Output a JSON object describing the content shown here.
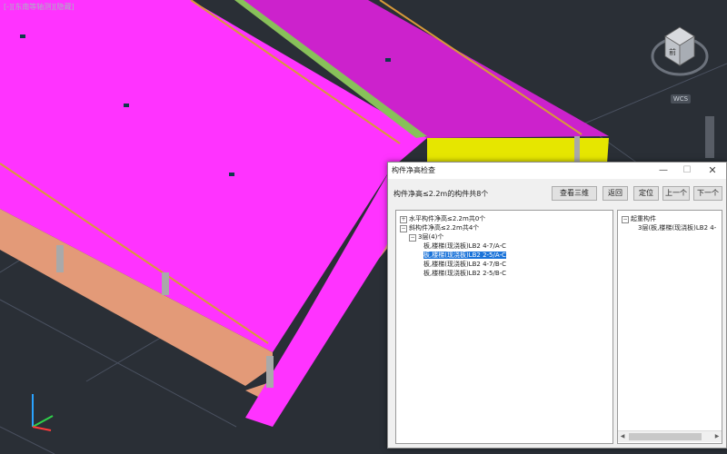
{
  "viewport": {
    "label": "[-][东南等轴测][隐藏]",
    "view_label": "WCS"
  },
  "viewcube": {
    "face_label": "前"
  },
  "colors": {
    "slab": "#ff33ff",
    "slab_dark": "#cc22cc",
    "wall_yellow": "#e6e600",
    "wall_brown": "#e39a78",
    "rail_green": "#88c05a",
    "background": "#2a2f36",
    "selection": "#1a73d9"
  },
  "dialog": {
    "title": "构件净高检查",
    "summary": "构件净高≤2.2m的构件共8个",
    "buttons": {
      "view_3d": "查看三维",
      "back": "返回",
      "locate": "定位",
      "prev": "上一个",
      "next": "下一个"
    },
    "tree": [
      {
        "text": "水平构件净高≤2.2m共0个",
        "level": 0,
        "expander": "+",
        "selected": false
      },
      {
        "text": "斜构件净高≤2.2m共4个",
        "level": 0,
        "expander": "−",
        "selected": false
      },
      {
        "text": "3层(4)个",
        "level": 1,
        "expander": "−",
        "selected": false
      },
      {
        "text": "板,楼梯(现浇板)LB2  4-7/A-C",
        "level": 2,
        "expander": "",
        "selected": false
      },
      {
        "text": "板,楼梯(现浇板)LB2  2-5/A-C",
        "level": 2,
        "expander": "",
        "selected": true
      },
      {
        "text": "板,楼梯(现浇板)LB2  4-7/B-C",
        "level": 2,
        "expander": "",
        "selected": false
      },
      {
        "text": "板,楼梯(现浇板)LB2  2-5/B-C",
        "level": 2,
        "expander": "",
        "selected": false
      }
    ],
    "detail": {
      "heading": "起重构件",
      "item": "3层(板,楼梯(现浇板)LB2  4-"
    }
  }
}
